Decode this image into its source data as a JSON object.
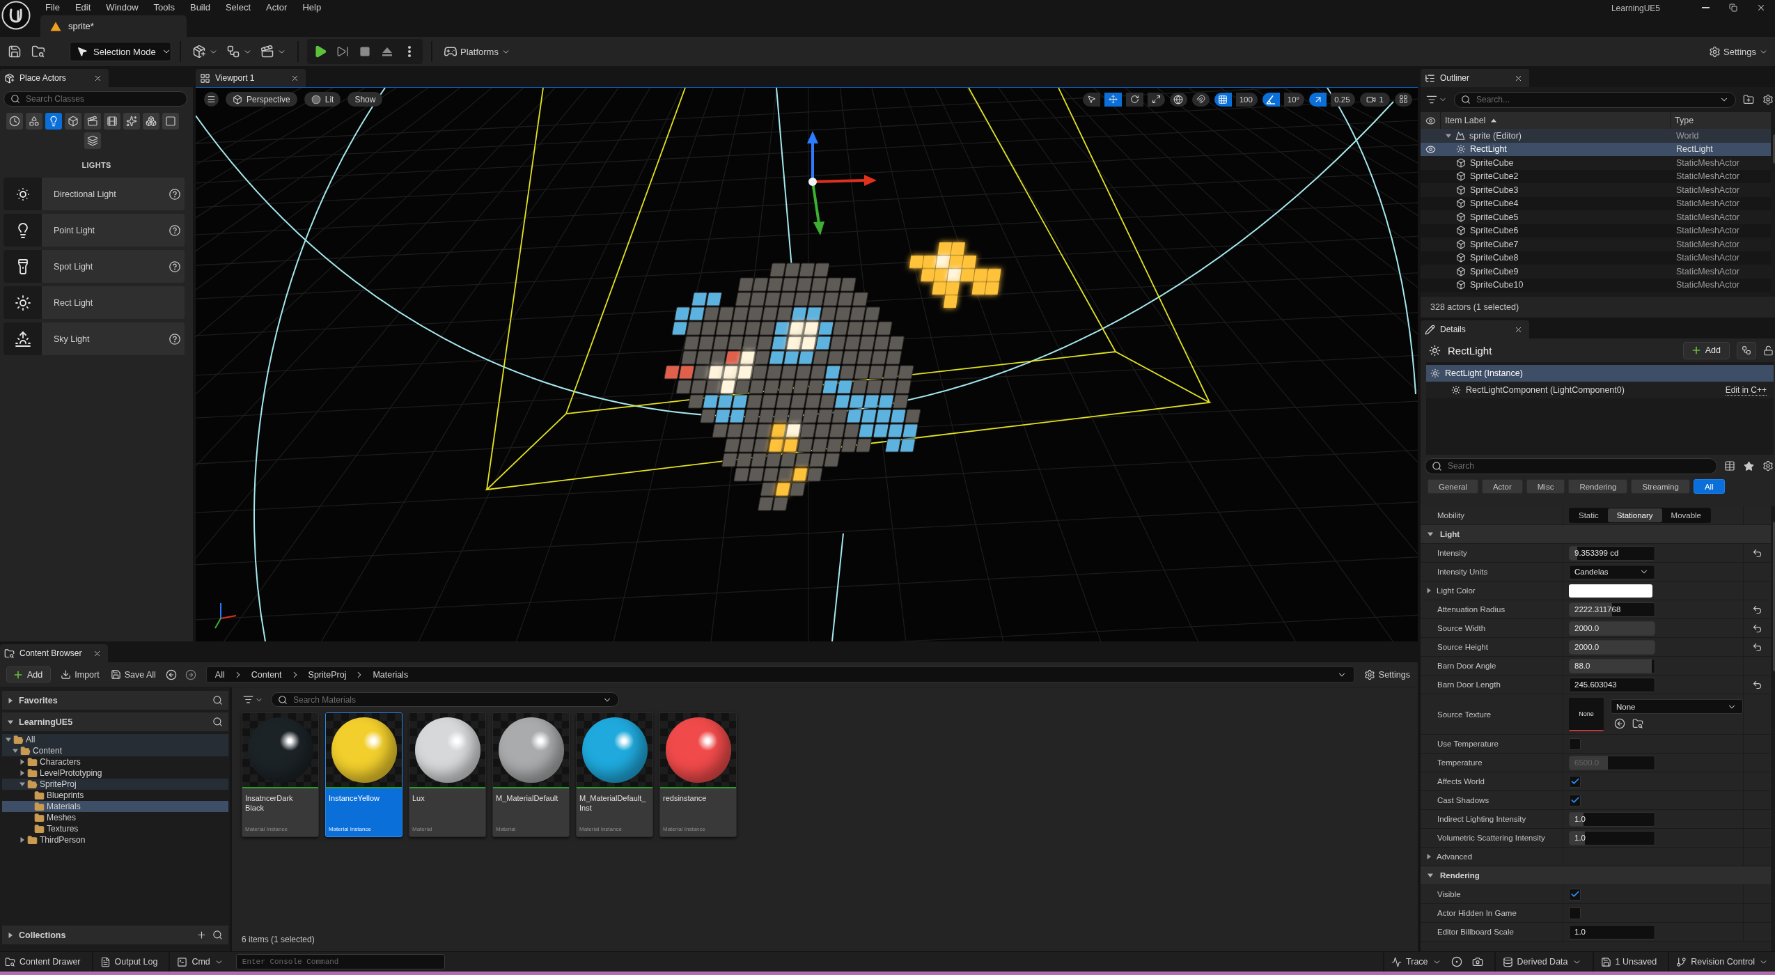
{
  "title_bar": {
    "menu": [
      "File",
      "Edit",
      "Window",
      "Tools",
      "Build",
      "Select",
      "Actor",
      "Help"
    ],
    "level_tab": "sprite*",
    "project": "LearningUE5"
  },
  "toolbar": {
    "mode": "Selection Mode",
    "platforms": "Platforms",
    "settings": "Settings"
  },
  "place_actors": {
    "tab": "Place Actors",
    "search": {
      "placeholder": "Search Classes"
    },
    "categories": [
      {
        "selected": false
      },
      {
        "selected": false
      },
      {
        "selected": true
      },
      {
        "selected": false
      },
      {
        "selected": false
      },
      {
        "selected": false
      },
      {
        "selected": false
      },
      {
        "selected": false
      },
      {
        "selected": false
      },
      {
        "selected": false
      }
    ],
    "heading": "LIGHTS",
    "items": [
      {
        "label": "Directional Light",
        "help": true
      },
      {
        "label": "Point Light",
        "help": true
      },
      {
        "label": "Spot Light",
        "help": true
      },
      {
        "label": "Rect Light",
        "help": false
      },
      {
        "label": "Sky Light",
        "help": true
      }
    ]
  },
  "viewport": {
    "tab": "Viewport 1",
    "view_mode": "Perspective",
    "lighting": "Lit",
    "show": "Show",
    "tools": [
      {
        "selected": false
      },
      {
        "selected": true
      },
      {
        "selected": false
      },
      {
        "selected": false
      }
    ],
    "snaps": [
      {
        "value": "100",
        "on": true
      },
      {
        "value": "10°",
        "on": true
      },
      {
        "value": "0.25",
        "on": true
      }
    ],
    "camera_speed": "1"
  },
  "outliner": {
    "tab": "Outliner",
    "search": {
      "placeholder": "Search..."
    },
    "columns": [
      "Item Label",
      "Type"
    ],
    "tree": [
      {
        "kind": "world",
        "label": "sprite (Editor)",
        "type": "World",
        "selected": false,
        "expanded": true,
        "children": [
          {
            "kind": "light",
            "label": "RectLight",
            "type": "RectLight",
            "selected": true
          },
          {
            "kind": "mesh",
            "label": "SpriteCube",
            "type": "StaticMeshActor",
            "selected": false
          },
          {
            "kind": "mesh",
            "label": "SpriteCube2",
            "type": "StaticMeshActor",
            "selected": false
          },
          {
            "kind": "mesh",
            "label": "SpriteCube3",
            "type": "StaticMeshActor",
            "selected": false
          },
          {
            "kind": "mesh",
            "label": "SpriteCube4",
            "type": "StaticMeshActor",
            "selected": false
          },
          {
            "kind": "mesh",
            "label": "SpriteCube5",
            "type": "StaticMeshActor",
            "selected": false
          },
          {
            "kind": "mesh",
            "label": "SpriteCube6",
            "type": "StaticMeshActor",
            "selected": false
          },
          {
            "kind": "mesh",
            "label": "SpriteCube7",
            "type": "StaticMeshActor",
            "selected": false
          },
          {
            "kind": "mesh",
            "label": "SpriteCube8",
            "type": "StaticMeshActor",
            "selected": false
          },
          {
            "kind": "mesh",
            "label": "SpriteCube9",
            "type": "StaticMeshActor",
            "selected": false
          },
          {
            "kind": "mesh",
            "label": "SpriteCube10",
            "type": "StaticMeshActor",
            "selected": false
          }
        ]
      }
    ],
    "footer": "328 actors (1 selected)"
  },
  "details": {
    "tab": "Details",
    "object": "RectLight",
    "add": "Add",
    "components": [
      {
        "label": "RectLight (Instance)",
        "selected": true,
        "children": [
          {
            "label": "RectLightComponent (LightComponent0)",
            "selected": false,
            "link": "Edit in C++"
          }
        ]
      }
    ],
    "search": {
      "placeholder": "Search"
    },
    "filters": [
      {
        "label": "General",
        "selected": false
      },
      {
        "label": "Actor",
        "selected": false
      },
      {
        "label": "Misc",
        "selected": false
      },
      {
        "label": "Rendering",
        "selected": false
      },
      {
        "label": "Streaming",
        "selected": false
      },
      {
        "label": "All",
        "selected": true
      }
    ],
    "mobility": {
      "label": "Mobility",
      "options": [
        {
          "label": "Static",
          "selected": false
        },
        {
          "label": "Stationary",
          "selected": true
        },
        {
          "label": "Movable",
          "selected": false
        }
      ]
    },
    "sections": [
      {
        "title": "Light",
        "expanded": true,
        "properties": [
          {
            "kind": "number",
            "label": "Intensity",
            "value": "9.353399 cd",
            "level": 0.09,
            "disabled": false,
            "reset": true
          },
          {
            "kind": "dropdown",
            "label": "Intensity Units",
            "value": "Candelas",
            "reset": false
          },
          {
            "kind": "color",
            "label": "Light Color",
            "expanded": false,
            "color": "#ffffff",
            "reset": false
          },
          {
            "kind": "number",
            "label": "Attenuation Radius",
            "value": "2222.311768",
            "level": 0.5,
            "disabled": false,
            "reset": true
          },
          {
            "kind": "number",
            "label": "Source Width",
            "value": "2000.0",
            "level": 1,
            "disabled": false,
            "reset": true
          },
          {
            "kind": "number",
            "label": "Source Height",
            "value": "2000.0",
            "level": 1,
            "disabled": false,
            "reset": true
          },
          {
            "kind": "number",
            "label": "Barn Door Angle",
            "value": "88.0",
            "level": 0.97,
            "disabled": false,
            "reset": false
          },
          {
            "kind": "number",
            "label": "Barn Door Length",
            "value": "245.603043",
            "disabled": false,
            "reset": true
          },
          {
            "kind": "texture",
            "label": "Source Texture",
            "thumbnail": "None",
            "value": "None",
            "reset": false
          },
          {
            "kind": "checkbox",
            "label": "Use Temperature",
            "checked": false,
            "reset": false
          },
          {
            "kind": "number",
            "label": "Temperature",
            "value": "6500.0",
            "level": 0.45,
            "disabled": true,
            "reset": false
          },
          {
            "kind": "checkbox",
            "label": "Affects World",
            "checked": true,
            "reset": false
          },
          {
            "kind": "checkbox",
            "label": "Cast Shadows",
            "checked": true,
            "reset": false
          },
          {
            "kind": "number",
            "label": "Indirect Lighting Intensity",
            "value": "1.0",
            "level": 0.16,
            "disabled": false,
            "reset": false
          },
          {
            "kind": "number",
            "label": "Volumetric Scattering Intensity",
            "value": "1.0",
            "level": 0.18,
            "disabled": false,
            "reset": false
          },
          {
            "kind": "group",
            "label": "Advanced",
            "expanded": false,
            "reset": false
          }
        ]
      },
      {
        "title": "Rendering",
        "expanded": true,
        "properties": [
          {
            "kind": "checkbox",
            "label": "Visible",
            "checked": true,
            "reset": false
          },
          {
            "kind": "checkbox",
            "label": "Actor Hidden In Game",
            "checked": false,
            "reset": false
          },
          {
            "kind": "number",
            "label": "Editor Billboard Scale",
            "value": "1.0",
            "disabled": false,
            "reset": false
          }
        ]
      }
    ]
  },
  "content_browser": {
    "tab": "Content Browser",
    "add": "Add",
    "import": "Import",
    "save_all": "Save All",
    "path": [
      "All",
      "Content",
      "SpriteProj",
      "Materials"
    ],
    "settings": "Settings",
    "sources": [
      {
        "label": "Favorites",
        "expanded": false
      },
      {
        "label": "LearningUE5",
        "expanded": true
      }
    ],
    "tree": [
      {
        "label": "All",
        "expanded": true,
        "selected": false,
        "on_path": true,
        "children": [
          {
            "label": "Content",
            "expanded": true,
            "selected": false,
            "on_path": true,
            "children": [
              {
                "label": "Characters",
                "expanded": false,
                "selected": false,
                "on_path": false
              },
              {
                "label": "LevelPrototyping",
                "expanded": false,
                "selected": false,
                "on_path": false
              },
              {
                "label": "SpriteProj",
                "expanded": true,
                "selected": false,
                "on_path": true,
                "children": [
                  {
                    "label": "Blueprints",
                    "selected": false,
                    "on_path": false
                  },
                  {
                    "label": "Materials",
                    "selected": true,
                    "on_path": false
                  },
                  {
                    "label": "Meshes",
                    "selected": false,
                    "on_path": false
                  },
                  {
                    "label": "Textures",
                    "selected": false,
                    "on_path": false
                  }
                ]
              },
              {
                "label": "ThirdPerson",
                "expanded": false,
                "selected": false,
                "on_path": false
              }
            ]
          }
        ]
      }
    ],
    "collections": {
      "label": "Collections",
      "expanded": false
    },
    "search": {
      "placeholder": "Search Materials"
    },
    "assets": [
      {
        "name": "InsatncerDark\nBlack",
        "type": "Material Instance",
        "color": "#1c2327",
        "selected": false
      },
      {
        "name": "InstanceYellow",
        "type": "Material Instance",
        "color": "#f2cf2c",
        "selected": true
      },
      {
        "name": "Lux",
        "type": "Material",
        "color": "#d6d8da",
        "selected": false
      },
      {
        "name": "M_MaterialDefault",
        "type": "Material",
        "color": "#a9abac",
        "selected": false
      },
      {
        "name": "M_MaterialDefault_\nInst",
        "type": "Material Instance",
        "color": "#1fa9dc",
        "selected": false
      },
      {
        "name": "redsinstance",
        "type": "Material Instance",
        "color": "#f04a4a",
        "selected": false
      }
    ],
    "footer": "6 items (1 selected)"
  },
  "status_bar": {
    "content_drawer": "Content Drawer",
    "output_log": "Output Log",
    "cmd": "Cmd",
    "console": {
      "placeholder": "Enter Console Command"
    },
    "trace": "Trace",
    "derived_data": "Derived Data",
    "unsaved": "1 Unsaved",
    "revision_control": "Revision Control"
  }
}
